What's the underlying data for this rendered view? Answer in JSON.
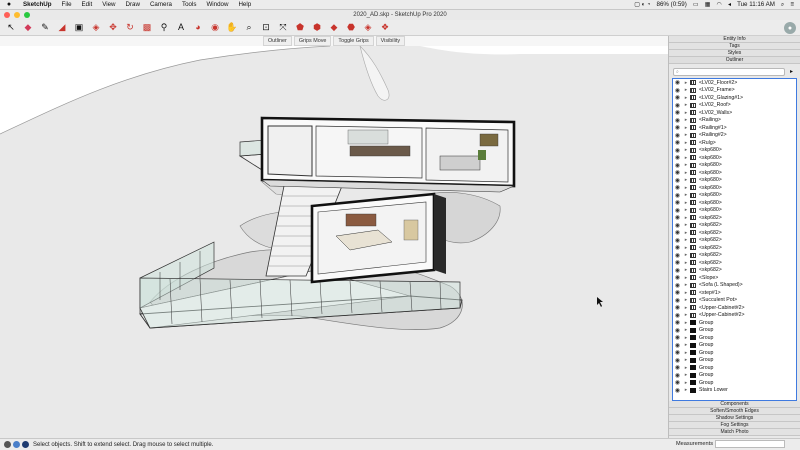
{
  "menubar": {
    "apple": "",
    "items": [
      "SketchUp",
      "File",
      "Edit",
      "View",
      "Draw",
      "Camera",
      "Tools",
      "Window",
      "Help"
    ],
    "battery": "86% (0:59)",
    "clock": "Tue 11:16 AM"
  },
  "window": {
    "title": "2020_AD.skp - SketchUp Pro 2020"
  },
  "toolbar": {
    "tools": [
      "select-tool",
      "eraser-tool",
      "line-tool",
      "rectangle-tool",
      "pushpull-tool",
      "move-tool",
      "rotate-tool",
      "offset-tool",
      "tape-measure-tool",
      "text-tool",
      "paint-bucket-tool",
      "orbit-tool",
      "pan-tool",
      "zoom-tool",
      "zoom-extents-tool",
      "warehouse-tool",
      "extension-warehouse-tool",
      "layout-tool",
      "extension-manager-tool",
      "ruby-tool",
      "style-builder-tool"
    ]
  },
  "tabs": [
    "Outliner",
    "Grips Move",
    "Toggle Grips",
    "Visibility"
  ],
  "tray": {
    "panels_top": [
      "Entity Info",
      "Tags",
      "Styles",
      "Outliner"
    ],
    "search_placeholder": "",
    "rows": [
      {
        "label": "<LV02_Floor#2>",
        "type": "comp"
      },
      {
        "label": "<LV02_Frame>",
        "type": "comp"
      },
      {
        "label": "<LV02_Glazing#1>",
        "type": "comp"
      },
      {
        "label": "<LV02_Roof>",
        "type": "comp"
      },
      {
        "label": "<LV02_Walls>",
        "type": "comp"
      },
      {
        "label": "<Railing>",
        "type": "comp"
      },
      {
        "label": "<Railing#1>",
        "type": "comp"
      },
      {
        "label": "<Railing#2>",
        "type": "comp"
      },
      {
        "label": "<Rulg>",
        "type": "comp"
      },
      {
        "label": "<skp680>",
        "type": "comp"
      },
      {
        "label": "<skp680>",
        "type": "comp"
      },
      {
        "label": "<skp680>",
        "type": "comp"
      },
      {
        "label": "<skp680>",
        "type": "comp"
      },
      {
        "label": "<skp680>",
        "type": "comp"
      },
      {
        "label": "<skp680>",
        "type": "comp"
      },
      {
        "label": "<skp680>",
        "type": "comp"
      },
      {
        "label": "<skp680>",
        "type": "comp"
      },
      {
        "label": "<skp680>",
        "type": "comp"
      },
      {
        "label": "<skp682>",
        "type": "comp"
      },
      {
        "label": "<skp682>",
        "type": "comp"
      },
      {
        "label": "<skp682>",
        "type": "comp"
      },
      {
        "label": "<skp682>",
        "type": "comp"
      },
      {
        "label": "<skp682>",
        "type": "comp"
      },
      {
        "label": "<skp682>",
        "type": "comp"
      },
      {
        "label": "<skp682>",
        "type": "comp"
      },
      {
        "label": "<skp682>",
        "type": "comp"
      },
      {
        "label": "<Slope>",
        "type": "comp"
      },
      {
        "label": "<Sofa (L Shaped)>",
        "type": "comp"
      },
      {
        "label": "<step#1>",
        "type": "comp"
      },
      {
        "label": "<Succulent Pot>",
        "type": "comp"
      },
      {
        "label": "<Upper-Cabinet#2>",
        "type": "comp"
      },
      {
        "label": "<Upper-Cabinet#2>",
        "type": "comp"
      },
      {
        "label": "Group",
        "type": "group"
      },
      {
        "label": "Group",
        "type": "group"
      },
      {
        "label": "Group",
        "type": "group"
      },
      {
        "label": "Group",
        "type": "group"
      },
      {
        "label": "Group",
        "type": "group"
      },
      {
        "label": "Group",
        "type": "group"
      },
      {
        "label": "Group",
        "type": "group"
      },
      {
        "label": "Group",
        "type": "group"
      },
      {
        "label": "Group",
        "type": "group"
      },
      {
        "label": "Stairs Lower",
        "type": "group"
      }
    ],
    "panels_bottom": [
      "Components",
      "Soften/Smooth Edges",
      "Shadow Settings",
      "Fog Settings",
      "Match Photo"
    ]
  },
  "status": {
    "hint": "Select objects. Shift to extend select. Drag mouse to select multiple.",
    "measurements_label": "Measurements"
  },
  "colors": {
    "accent": "#3f7ae0",
    "toolbar_red": "#c8342c"
  }
}
